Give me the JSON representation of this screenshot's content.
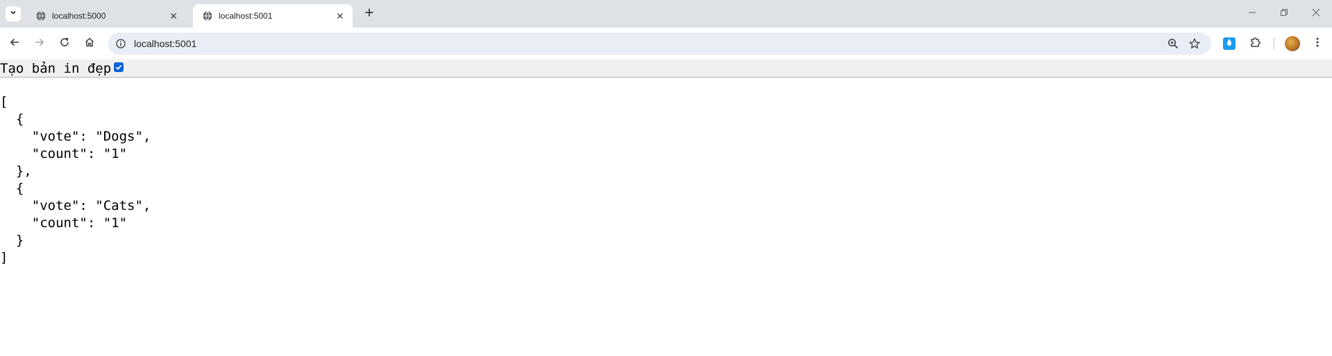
{
  "browser": {
    "tabs": [
      {
        "title": "localhost:5000",
        "active": false,
        "favicon": "globe-icon"
      },
      {
        "title": "localhost:5001",
        "active": true,
        "favicon": "globe-icon"
      }
    ],
    "address_bar": {
      "url": "localhost:5001"
    },
    "icons": {
      "tab_search": "chevron-down-icon",
      "new_tab": "plus-icon",
      "back": "arrow-left-icon",
      "forward": "arrow-right-icon",
      "reload": "reload-icon",
      "home": "home-icon",
      "site_info": "info-icon",
      "zoom": "zoom-icon",
      "bookmark": "star-icon",
      "extension": "water-drop-icon",
      "extensions_menu": "puzzle-icon",
      "menu": "kebab-menu-icon",
      "minimize": "minimize-icon",
      "restore": "restore-icon",
      "close": "close-icon"
    },
    "colors": {
      "tab_strip": "#dee1e6",
      "omnibox": "#e9eef6",
      "checkbox": "#0b63d8",
      "extension": "#1a9bf0"
    }
  },
  "page": {
    "pretty_print_label": "Tạo bản in đẹp",
    "pretty_print_checked": true,
    "json_lines": [
      "[",
      "  {",
      "    \"vote\": \"Dogs\",",
      "    \"count\": \"1\"",
      "  },",
      "  {",
      "    \"vote\": \"Cats\",",
      "    \"count\": \"1\"",
      "  }",
      "]"
    ]
  }
}
